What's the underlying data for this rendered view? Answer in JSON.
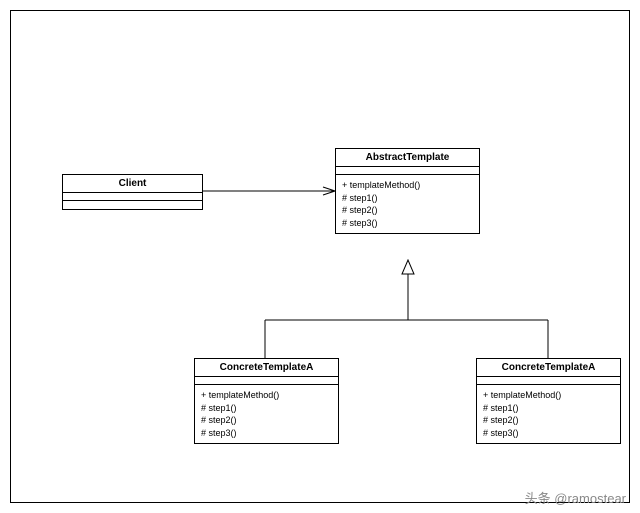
{
  "diagram": {
    "client": {
      "title": "Client"
    },
    "abstract": {
      "title": "AbstractTemplate",
      "ops": [
        "+ templateMethod()",
        "# step1()",
        "# step2()",
        "# step3()"
      ]
    },
    "concreteA": {
      "title": "ConcreteTemplateA",
      "ops": [
        "+ templateMethod()",
        "# step1()",
        "# step2()",
        "# step3()"
      ]
    },
    "concreteB": {
      "title": "ConcreteTemplateA",
      "ops": [
        "+ templateMethod()",
        "# step1()",
        "# step2()",
        "# step3()"
      ]
    }
  },
  "watermark": "头条 @ramostear"
}
